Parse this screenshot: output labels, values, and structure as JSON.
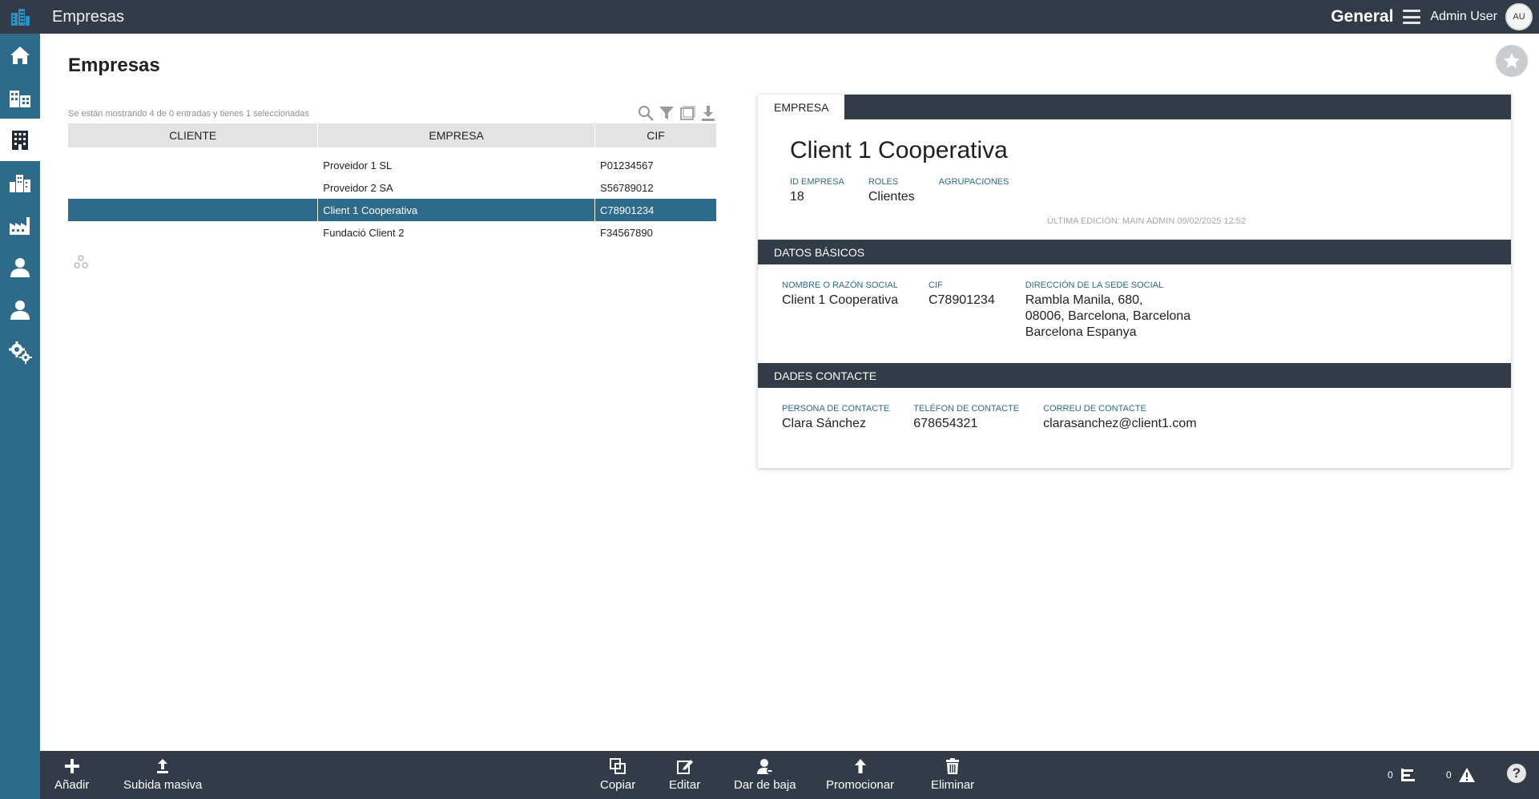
{
  "topbar": {
    "app_title": "Empresas",
    "context": "General",
    "user_name": "Admin User",
    "avatar_initials": "AU"
  },
  "sidebar": {
    "items": [
      {
        "icon": "home-icon",
        "active": false
      },
      {
        "icon": "buildings-icon",
        "active": false
      },
      {
        "icon": "office-building-icon",
        "active": true
      },
      {
        "icon": "city-icon",
        "active": false
      },
      {
        "icon": "factory-icon",
        "active": false
      },
      {
        "icon": "contact-person-icon",
        "active": false
      },
      {
        "icon": "user-icon",
        "active": false
      },
      {
        "icon": "settings-icon",
        "active": false
      }
    ]
  },
  "page": {
    "title": "Empresas"
  },
  "list": {
    "info": "Se están mostrando 4 de 0 entradas y tienes 1 seleccionadas",
    "columns": [
      "CLIENTE",
      "EMPRESA",
      "CIF"
    ],
    "rows": [
      {
        "cliente": "",
        "empresa": "Proveidor 1 SL",
        "cif": "P01234567",
        "selected": false
      },
      {
        "cliente": "",
        "empresa": "Proveidor 2 SA",
        "cif": "S56789012",
        "selected": false
      },
      {
        "cliente": "",
        "empresa": "Client 1 Cooperativa",
        "cif": "C78901234",
        "selected": true
      },
      {
        "cliente": "",
        "empresa": "Fundació Client 2",
        "cif": "F34567890",
        "selected": false
      }
    ]
  },
  "detail": {
    "tab_label": "EMPRESA",
    "entity_name": "Client 1 Cooperativa",
    "meta": {
      "id_label": "ID EMPRESA",
      "id_value": "18",
      "roles_label": "ROLES",
      "roles_value": "Clientes",
      "groups_label": "AGRUPACIONES",
      "groups_value": ""
    },
    "last_edit": "ÚLTIMA EDICIÓN: MAIN ADMIN 09/02/2025 12:52",
    "basic": {
      "section_title": "DATOS BÁSICOS",
      "name_label": "NOMBRE O RAZÓN SOCIAL",
      "name_value": "Client 1 Cooperativa",
      "cif_label": "CIF",
      "cif_value": "C78901234",
      "address_label": "DIRECCIÓN DE LA SEDE SOCIAL",
      "address_line1": "Rambla Manila, 680,",
      "address_line2": "08006, Barcelona, Barcelona",
      "address_line3": "Barcelona Espanya"
    },
    "contact": {
      "section_title": "DADES CONTACTE",
      "person_label": "PERSONA DE CONTACTE",
      "person_value": "Clara Sánchez",
      "phone_label": "TELÉFON DE CONTACTE",
      "phone_value": "678654321",
      "email_label": "CORREU DE CONTACTE",
      "email_value": "clarasanchez@client1.com"
    }
  },
  "toolbar": {
    "add": "Añadir",
    "bulk_upload": "Subida masiva",
    "copy": "Copiar",
    "edit": "Editar",
    "deactivate": "Dar de baja",
    "promote": "Promocionar",
    "delete": "Eliminar",
    "tasks_count": "0",
    "alerts_count": "0",
    "help": "?"
  },
  "colors": {
    "dark": "#323b48",
    "accent": "#2e6a8a"
  }
}
